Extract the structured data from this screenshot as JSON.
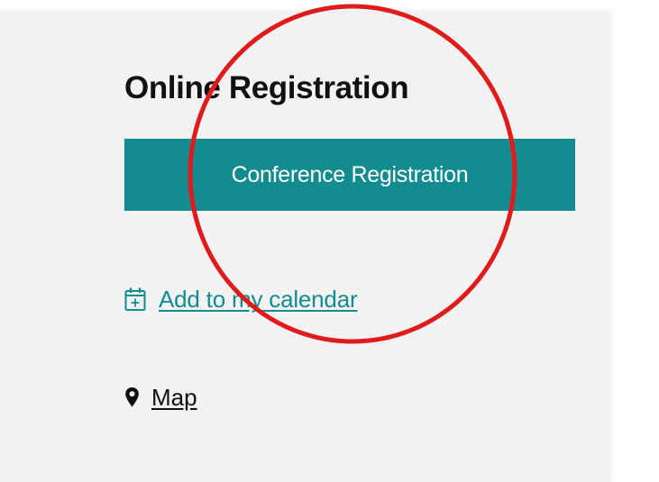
{
  "sidebar": {
    "title": "Online Registration",
    "register_button_label": "Conference Registration",
    "calendar_link_label": "Add to my calendar",
    "map_link_label": "Map"
  },
  "icons": {
    "calendar": "calendar-add-icon",
    "map": "map-pin-icon"
  },
  "colors": {
    "accent": "#138c8f",
    "annotation": "#e01b1b",
    "panel_background": "#f2f2f2"
  }
}
